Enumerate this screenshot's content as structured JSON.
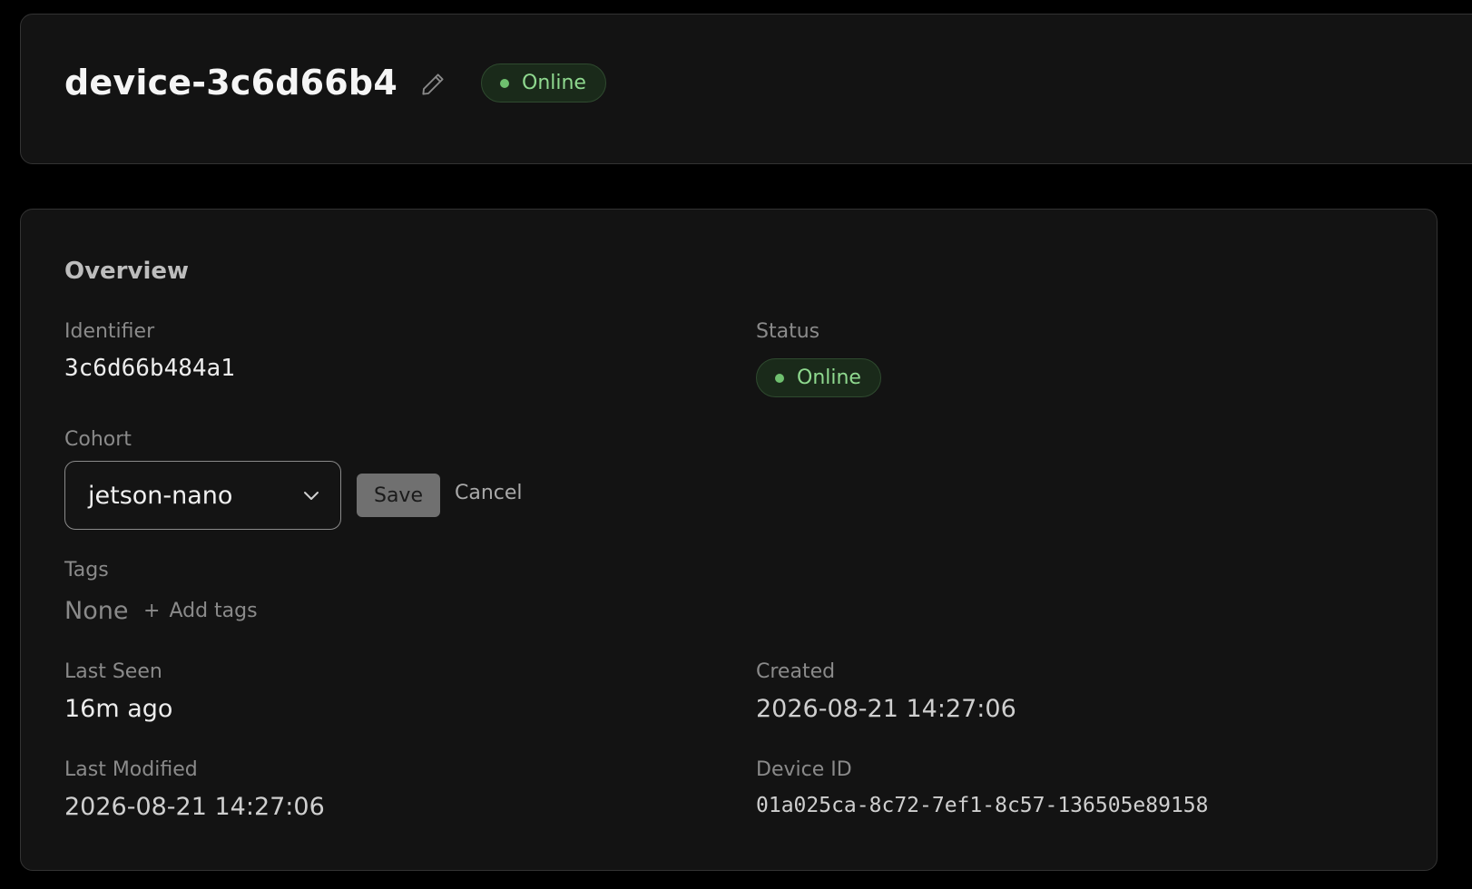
{
  "header": {
    "device_name": "device-3c6d66b4",
    "status_label": "Online"
  },
  "overview": {
    "title": "Overview",
    "identifier": {
      "label": "Identifier",
      "value": "3c6d66b484a1"
    },
    "status": {
      "label": "Status",
      "value": "Online"
    },
    "cohort": {
      "label": "Cohort",
      "selected": "jetson-nano",
      "save_label": "Save",
      "cancel_label": "Cancel"
    },
    "tags": {
      "label": "Tags",
      "empty_value": "None",
      "add_label": "Add tags"
    },
    "last_seen": {
      "label": "Last Seen",
      "value": "16m ago"
    },
    "created": {
      "label": "Created",
      "value": "2026-08-21 14:27:06"
    },
    "last_modified": {
      "label": "Last Modified",
      "value": "2026-08-21 14:27:06"
    },
    "device_id": {
      "label": "Device ID",
      "value": "01a025ca-8c72-7ef1-8c57-136505e89158"
    }
  },
  "icons": {
    "edit": "pencil-icon",
    "select": "chevron-down-icon",
    "add": "plus-icon",
    "status": "status-dot-icon"
  },
  "colors": {
    "background": "#000000",
    "card": "#131313",
    "status_online_text": "#8fd98f",
    "status_online_dot": "#6fc06f"
  }
}
